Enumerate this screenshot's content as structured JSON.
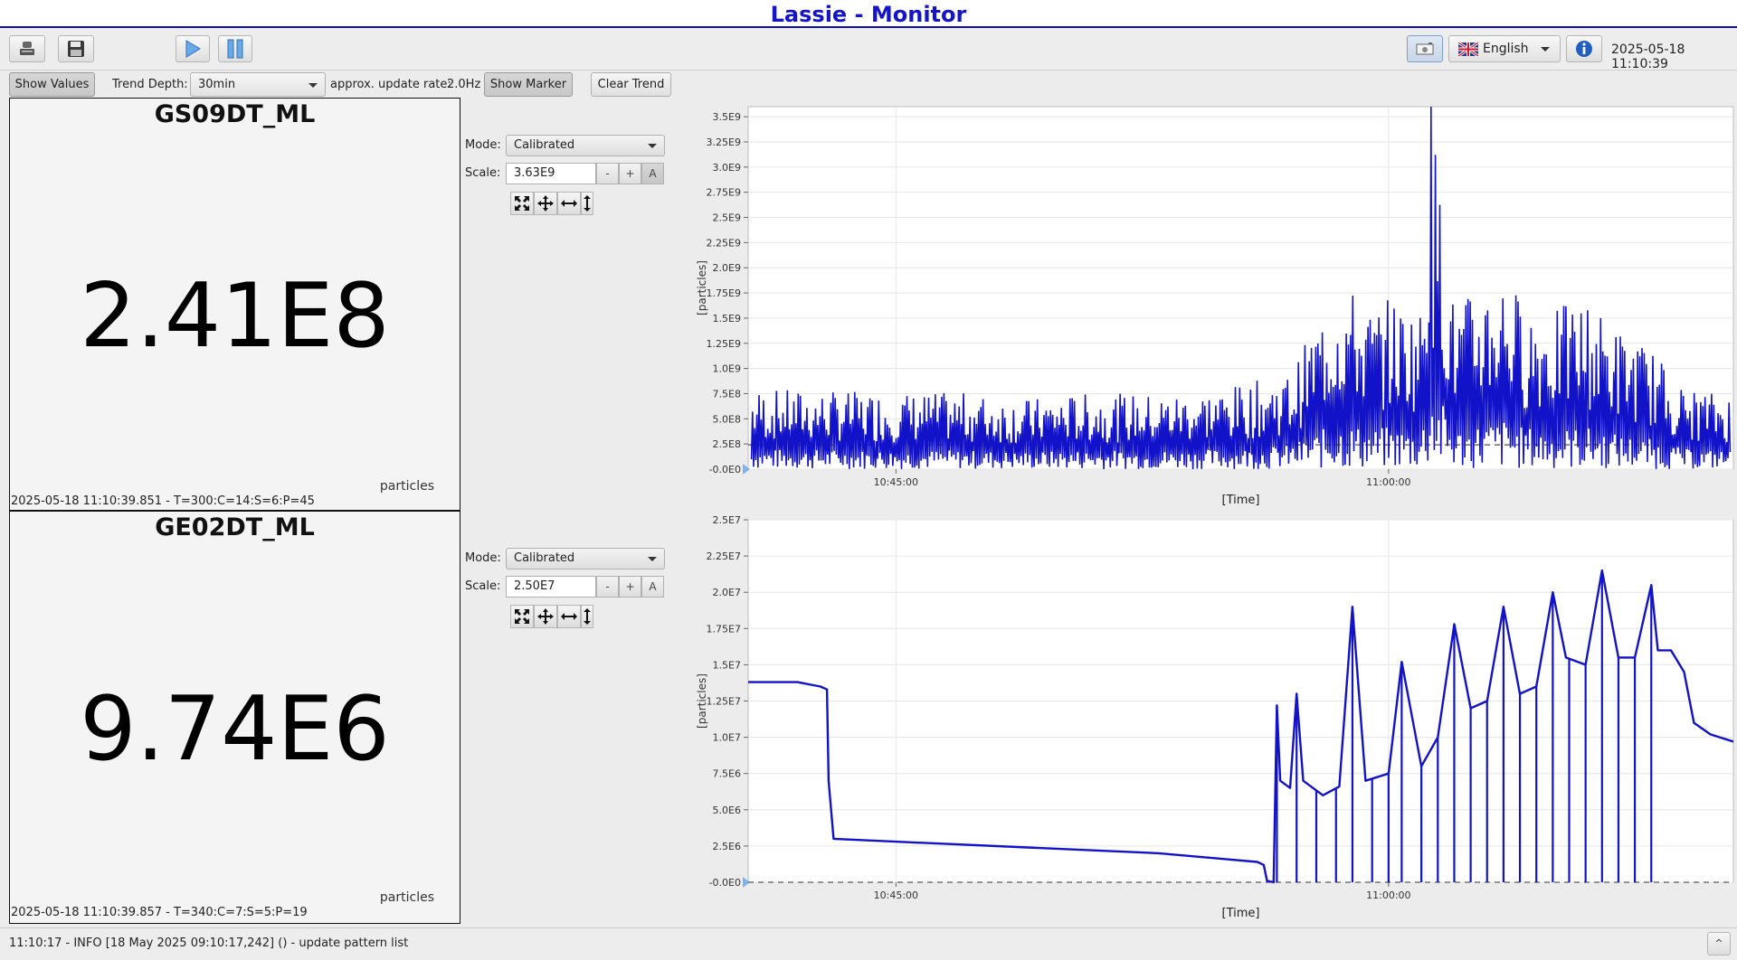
{
  "window": {
    "title": "Lassie - Monitor"
  },
  "toolbar": {
    "language": "English",
    "datetime": "2025-05-18 11:10:39",
    "icons": [
      "database-icon",
      "save-icon",
      "play-icon",
      "pause-icon",
      "screenshot-icon",
      "uk-flag-icon",
      "info-icon"
    ]
  },
  "controls": {
    "show_values": "Show Values",
    "trend_depth_label": "Trend Depth:",
    "trend_depth_value": "30min",
    "update_rate_label": "approx. update rate:",
    "update_rate_value": "2.0Hz",
    "show_marker": "Show Marker",
    "clear_trend": "Clear Trend"
  },
  "panels": [
    {
      "name": "GS09DT_ML",
      "value": "2.41E8",
      "unit": "particles",
      "footer": "2025-05-18 11:10:39.851 - T=300:C=14:S=6:P=45",
      "mode_label": "Mode:",
      "mode_value": "Calibrated",
      "scale_label": "Scale:",
      "scale_value": "3.63E9",
      "minus": "-",
      "plus": "+",
      "auto": "A"
    },
    {
      "name": "GE02DT_ML",
      "value": "9.74E6",
      "unit": "particles",
      "footer": "2025-05-18 11:10:39.857 - T=340:C=7:S=5:P=19",
      "mode_label": "Mode:",
      "mode_value": "Calibrated",
      "scale_label": "Scale:",
      "scale_value": "2.50E7",
      "minus": "-",
      "plus": "+",
      "auto": "A"
    }
  ],
  "chart_data": [
    {
      "type": "line",
      "ylabel": "[particles]",
      "xlabel": "[Time]",
      "yticks": [
        "-0.0E0",
        "2.5E8",
        "5.0E8",
        "7.5E8",
        "1.0E9",
        "1.25E9",
        "1.5E9",
        "1.75E9",
        "2.0E9",
        "2.25E9",
        "2.5E9",
        "2.75E9",
        "3.0E9",
        "3.25E9",
        "3.5E9"
      ],
      "ylim": [
        0,
        3600000000.0
      ],
      "xticks": [
        "10:45:00",
        "11:00:00"
      ],
      "xlim_minutes": [
        -4.5,
        25.5
      ],
      "series_color": "#1212c8",
      "baseline": 241000000.0,
      "envelope": [
        [
          -4.4,
          800000000.0
        ],
        [
          0,
          760000000.0
        ],
        [
          2,
          760000000.0
        ],
        [
          4,
          700000000.0
        ],
        [
          6,
          760000000.0
        ],
        [
          8,
          740000000.0
        ],
        [
          10,
          800000000.0
        ],
        [
          12,
          960000000.0
        ],
        [
          13.5,
          1900000000.0
        ],
        [
          14.5,
          1600000000.0
        ],
        [
          15,
          1700000000.0
        ],
        [
          16,
          1600000000.0
        ],
        [
          16.3,
          3600000000.0
        ],
        [
          17,
          1600000000.0
        ],
        [
          18,
          1900000000.0
        ],
        [
          18.6,
          2000000000.0
        ],
        [
          19,
          1700000000.0
        ],
        [
          20,
          1600000000.0
        ],
        [
          21,
          1700000000.0
        ],
        [
          22,
          1400000000.0
        ],
        [
          23,
          1200000000.0
        ],
        [
          24,
          800000000.0
        ],
        [
          25.4,
          750000000.0
        ]
      ]
    },
    {
      "type": "line",
      "ylabel": "[particles]",
      "xlabel": "[Time]",
      "yticks": [
        "-0.0E0",
        "2.5E6",
        "5.0E6",
        "7.5E6",
        "1.0E7",
        "1.25E7",
        "1.5E7",
        "1.75E7",
        "2.0E7",
        "2.25E7",
        "2.5E7"
      ],
      "ylim": [
        0,
        25000000.0
      ],
      "xticks": [
        "10:45:00",
        "11:00:00"
      ],
      "xlim_minutes": [
        -4.5,
        25.5
      ],
      "series_color": "#1212c8",
      "points": [
        [
          -4.5,
          13800000.0
        ],
        [
          -3.0,
          13800000.0
        ],
        [
          -2.3,
          13500000.0
        ],
        [
          -2.1,
          13300000.0
        ],
        [
          -2.05,
          7000000.0
        ],
        [
          -1.9,
          3000000.0
        ],
        [
          0,
          2800000.0
        ],
        [
          4,
          2400000.0
        ],
        [
          8,
          2000000.0
        ],
        [
          10,
          1600000.0
        ],
        [
          11.0,
          1400000.0
        ],
        [
          11.2,
          1200000.0
        ],
        [
          11.3,
          100000.0
        ],
        [
          11.5,
          0.0
        ],
        [
          11.6,
          12200000.0
        ],
        [
          11.7,
          7000000.0
        ],
        [
          12,
          6500000.0
        ],
        [
          12.2,
          13000000.0
        ],
        [
          12.4,
          7000000.0
        ],
        [
          13,
          6000000.0
        ],
        [
          13.5,
          6600000.0
        ],
        [
          13.9,
          19000000.0
        ],
        [
          14.3,
          7000000.0
        ],
        [
          15,
          7500000.0
        ],
        [
          15.4,
          15200000.0
        ],
        [
          16,
          8000000.0
        ],
        [
          16.5,
          10000000.0
        ],
        [
          17.0,
          17800000.0
        ],
        [
          17.5,
          12000000.0
        ],
        [
          18,
          12500000.0
        ],
        [
          18.5,
          19000000.0
        ],
        [
          19,
          13000000.0
        ],
        [
          19.5,
          13500000.0
        ],
        [
          20,
          20000000.0
        ],
        [
          20.4,
          15500000.0
        ],
        [
          21,
          15000000.0
        ],
        [
          21.5,
          21500000.0
        ],
        [
          22,
          15500000.0
        ],
        [
          22.5,
          15500000.0
        ],
        [
          23,
          20500000.0
        ],
        [
          23.2,
          16000000.0
        ],
        [
          23.6,
          16000000.0
        ],
        [
          24.0,
          14500000.0
        ],
        [
          24.3,
          11000000.0
        ],
        [
          24.8,
          10200000.0
        ],
        [
          25.5,
          9700000.0
        ]
      ],
      "spikes_to_zero": [
        11.6,
        12.2,
        12.8,
        13.4,
        13.9,
        14.5,
        15.0,
        15.4,
        16.0,
        16.5,
        17.0,
        17.5,
        18.0,
        18.5,
        19.0,
        19.5,
        20.0,
        20.5,
        21.0,
        21.5,
        22.0,
        22.5,
        23.0
      ]
    }
  ],
  "status": {
    "message": "11:10:17 -  INFO [18 May 2025 09:10:17,242] () - update pattern list"
  }
}
